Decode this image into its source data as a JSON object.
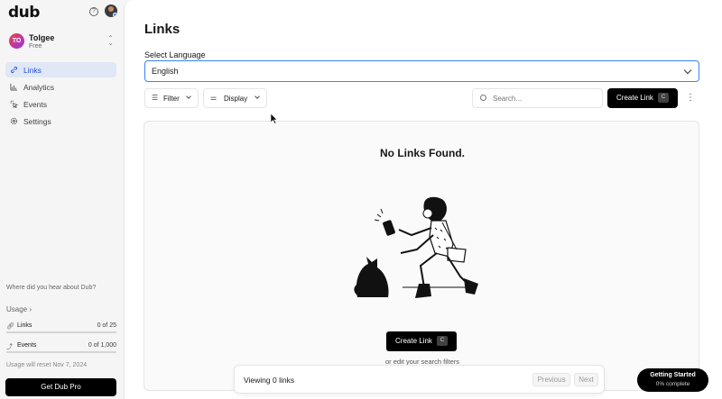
{
  "brand": {
    "logo": "dub"
  },
  "header": {
    "help_icon": "help-circle-icon",
    "user_avatar": "user-avatar"
  },
  "workspace": {
    "initials": "TO",
    "name": "Tolgee",
    "plan": "Free"
  },
  "sidebar": {
    "items": [
      {
        "label": "Links",
        "icon": "link-icon",
        "active": true
      },
      {
        "label": "Analytics",
        "icon": "bar-chart-icon",
        "active": false
      },
      {
        "label": "Events",
        "icon": "cursor-click-icon",
        "active": false
      },
      {
        "label": "Settings",
        "icon": "gear-icon",
        "active": false
      }
    ],
    "hear_prompt": "Where did you hear about Dub?",
    "usage": {
      "title": "Usage",
      "rows": [
        {
          "label": "Links",
          "value": "0 of 25",
          "icon": "link-icon"
        },
        {
          "label": "Events",
          "value": "0 of 1,000",
          "icon": "cursor-click-icon"
        }
      ],
      "reset_text": "Usage will reset Nov 7, 2024"
    },
    "cta": "Get Dub Pro"
  },
  "main": {
    "title": "Links",
    "language": {
      "label": "Select Language",
      "value": "English"
    },
    "toolbar": {
      "filter": "Filter",
      "display": "Display",
      "search_placeholder": "Search...",
      "create": "Create Link",
      "create_shortcut": "C"
    },
    "empty": {
      "title": "No Links Found.",
      "create": "Create Link",
      "create_shortcut": "C",
      "hint": "or edit your search filters"
    },
    "footer": {
      "viewing": "Viewing 0 links",
      "previous": "Previous",
      "next": "Next"
    }
  },
  "onboarding": {
    "title": "Getting Started",
    "progress": "0% complete"
  },
  "colors": {
    "accent": "#3b82f6",
    "active_nav_bg": "#e0e7f5",
    "primary_button": "#000000"
  }
}
